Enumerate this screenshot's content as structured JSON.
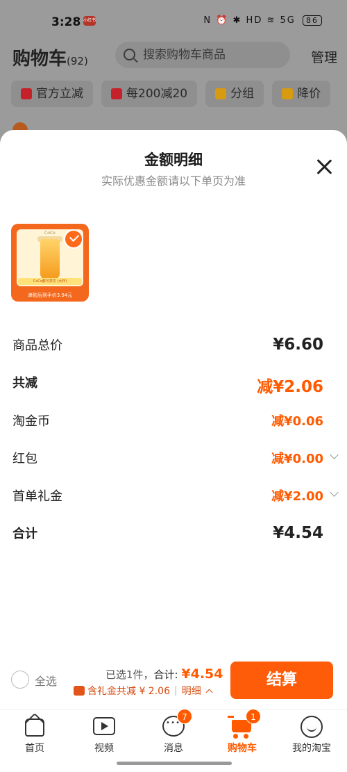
{
  "status_bar": {
    "time": "3:28",
    "app_badge": "小红书",
    "right_icons": "N ⏰ ✱ HD ≋ 5G",
    "battery": "86"
  },
  "background_page": {
    "title": "购物车",
    "count": "(92)",
    "search_placeholder": "搜索购物车商品",
    "manage": "管理",
    "chips": [
      {
        "label": "官方立减",
        "color": "#c4212a"
      },
      {
        "label": "每200减20",
        "color": "#c4212a"
      },
      {
        "label": "分组",
        "color": "#d79b12"
      },
      {
        "label": "降价",
        "color": "#d79b12"
      }
    ]
  },
  "sheet": {
    "title": "金额明细",
    "subtitle": "实际优惠金额请以下单页为准",
    "product": {
      "brand": "CoCo",
      "band_text": "CoCo都可茶饮 (大杯)",
      "footer": "津贴后到手价3.94元"
    },
    "rows": [
      {
        "label": "商品总价",
        "value": "¥6.60"
      },
      {
        "label": "共减",
        "value": "减¥2.06"
      },
      {
        "label": "淘金币",
        "value": "减¥0.06"
      },
      {
        "label": "红包",
        "value": "减¥0.00"
      },
      {
        "label": "首单礼金",
        "value": "减¥2.00"
      },
      {
        "label": "合计",
        "value": "¥4.54"
      }
    ]
  },
  "bottom_bar": {
    "select_all": "全选",
    "selected_text": "已选1件，",
    "total_label": "合计:",
    "total_value": "¥4.54",
    "gift_text": "含礼金共减 ¥ 2.06",
    "detail_label": "明细",
    "settle_button": "结算"
  },
  "tabbar": {
    "items": [
      {
        "label": "首页",
        "badge": ""
      },
      {
        "label": "视频",
        "badge": ""
      },
      {
        "label": "消息",
        "badge": "7"
      },
      {
        "label": "购物车",
        "badge": "1"
      },
      {
        "label": "我的淘宝",
        "badge": ""
      }
    ]
  },
  "colors": {
    "accent": "#ff5a00",
    "button": "#ff5c0a"
  }
}
